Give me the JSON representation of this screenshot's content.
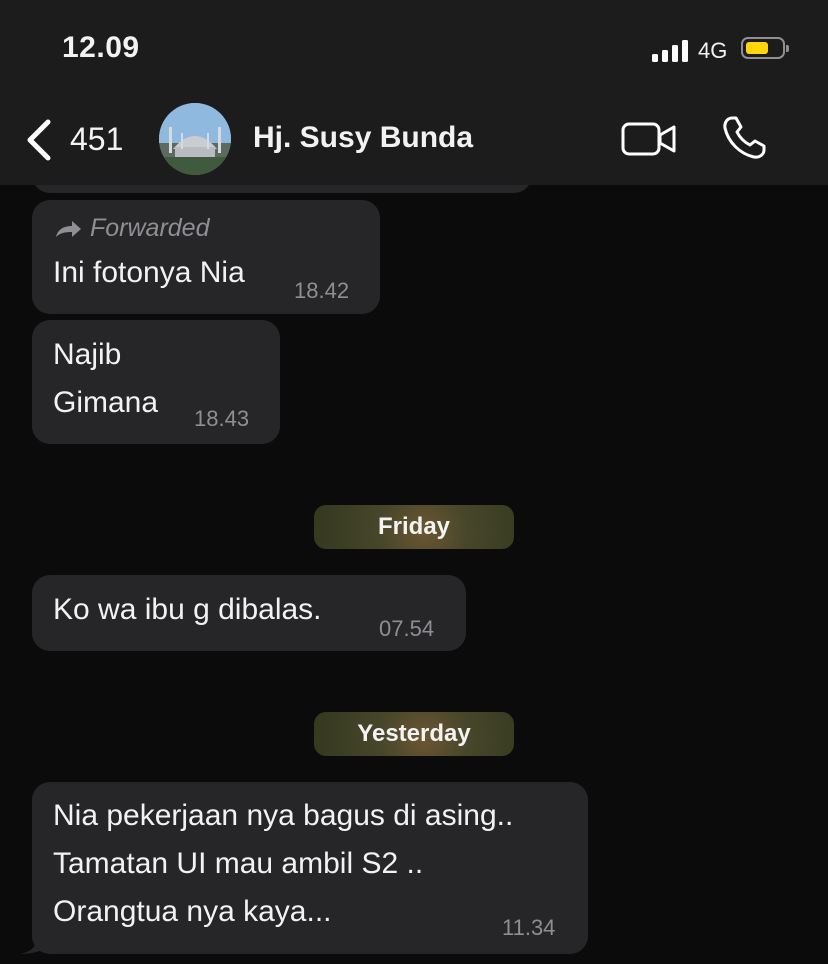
{
  "status_bar": {
    "time": "12.09",
    "network": "4G",
    "battery_color": "#ffd60a"
  },
  "header": {
    "back_icon": "chevron-left-icon",
    "back_count": "451",
    "contact_name": "Hj. Susy Bunda",
    "video_icon": "video-camera-icon",
    "call_icon": "phone-icon"
  },
  "messages": [
    {
      "forwarded_label": "Forwarded",
      "text": "Ini fotonya Nia",
      "time": "18.42"
    },
    {
      "text": "Najib\nGimana",
      "time": "18.43"
    },
    {
      "text": "Ko wa ibu g dibalas.",
      "time": "07.54"
    },
    {
      "text": "Nia pekerjaan nya bagus di asing..\nTamatan UI mau ambil S2 ..\nOrangtua nya kaya...",
      "time": "11.34"
    }
  ],
  "date_separators": [
    "Friday",
    "Yesterday"
  ],
  "colors": {
    "bubble": "#262628",
    "header": "#1c1c1d",
    "timestamp": "#8e8e93"
  }
}
